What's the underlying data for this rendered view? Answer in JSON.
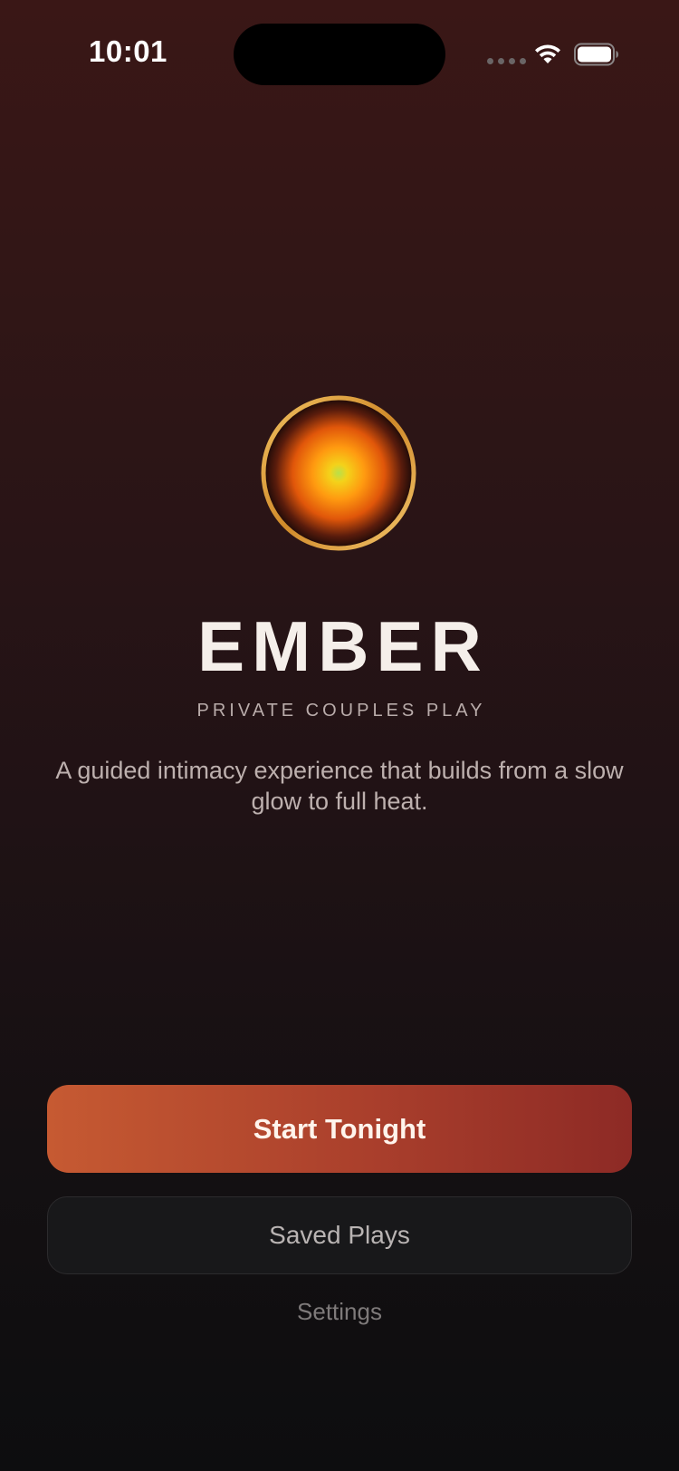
{
  "status_bar": {
    "time": "10:01"
  },
  "icons": {
    "logo": "ember-orb-logo",
    "wifi": "wifi-icon",
    "battery": "battery-icon",
    "signal": "cellular-signal-icon"
  },
  "brand": {
    "title": "EMBER",
    "subtitle": "PRIVATE COUPLES PLAY",
    "description": "A guided intimacy experience that builds from a slow glow to full heat."
  },
  "actions": {
    "primary_label": "Start Tonight",
    "secondary_label": "Saved Plays",
    "tertiary_label": "Settings"
  },
  "colors": {
    "accent_start": "#c65a32",
    "accent_end": "#8d2a25",
    "background_top": "#3a1716",
    "background_bottom": "#0d0d0f",
    "orb_gold_ring": "#d9a040"
  }
}
